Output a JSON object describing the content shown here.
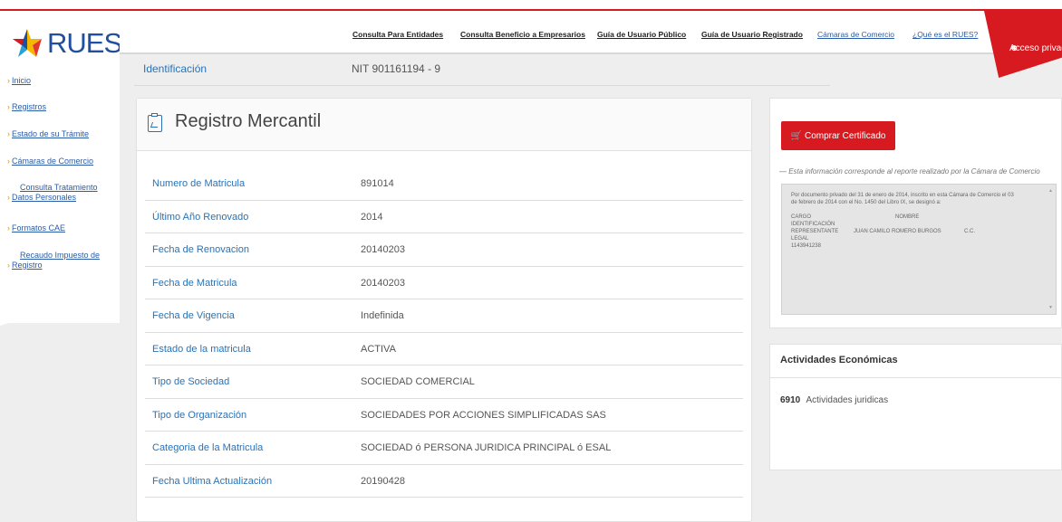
{
  "brand": {
    "logo_text": "RUES"
  },
  "sidebar": {
    "items": [
      {
        "label": "Inicio"
      },
      {
        "label": "Registros"
      },
      {
        "label": "Estado de su Trámite"
      },
      {
        "label": "Cámaras de Comercio"
      },
      {
        "label": "Consulta Tratamiento",
        "label2": "Datos Personales"
      },
      {
        "label": "Formatos CAE"
      },
      {
        "label": "Recaudo Impuesto de",
        "label2": "Registro"
      }
    ]
  },
  "header": {
    "nav": [
      {
        "label": "Consulta Para Entidades"
      },
      {
        "label": "Consulta Beneficio a Empresarios"
      },
      {
        "label": "Guía de Usuario Público"
      },
      {
        "label": "Guía de Usuario Registrado"
      },
      {
        "label": "Cámaras de Comercio"
      },
      {
        "label": "¿Qué es el RUES?"
      }
    ],
    "acceso_label": "Acceso privado"
  },
  "identificacion": {
    "label": "Identificación",
    "value": "NIT 901161194 - 9"
  },
  "registro": {
    "title": "Registro Mercantil",
    "rows": [
      {
        "label": "Numero de Matricula",
        "value": "891014"
      },
      {
        "label": "Último Año Renovado",
        "value": "2014"
      },
      {
        "label": "Fecha de Renovacion",
        "value": "20140203"
      },
      {
        "label": "Fecha de Matricula",
        "value": "20140203"
      },
      {
        "label": "Fecha de Vigencia",
        "value": "Indefinida"
      },
      {
        "label": "Estado de la matricula",
        "value": "ACTIVA"
      },
      {
        "label": "Tipo de Sociedad",
        "value": "SOCIEDAD COMERCIAL"
      },
      {
        "label": "Tipo de Organización",
        "value": "SOCIEDADES POR ACCIONES SIMPLIFICADAS SAS"
      },
      {
        "label": "Categoria de la Matricula",
        "value": "SOCIEDAD ó PERSONA JURIDICA PRINCIPAL ó ESAL"
      },
      {
        "label": "Fecha Ultima Actualización",
        "value": "20190428"
      }
    ]
  },
  "certificado": {
    "button_label": "Comprar Certificado",
    "note": "— Esta información corresponde al reporte realizado por la Cámara de Comercio",
    "text_paragraph": "Por documento privado del 31 de enero de 2014, inscrito en esta Cámara de Comercio el 03 de febrero de 2014 con el No. 1450 del Libro IX, se designó a:",
    "col_cargo": "CARGO",
    "col_nombre": "NOMBRE",
    "col_identificacion": "IDENTIFICACIÓN",
    "line_cargo": "REPRESENTANTE LEGAL",
    "line_nombre": "JUAN CAMILO ROMERO BURGOS",
    "line_tipo": "C.C.",
    "line_id": "1143941238"
  },
  "actividades": {
    "title": "Actividades Económicas",
    "items": [
      {
        "code": "6910",
        "label": "Actividades juridicas"
      }
    ]
  },
  "colors": {
    "accent_red": "#d71920",
    "link_blue": "#2a72b5",
    "chevron_yellow": "#f5b800"
  }
}
